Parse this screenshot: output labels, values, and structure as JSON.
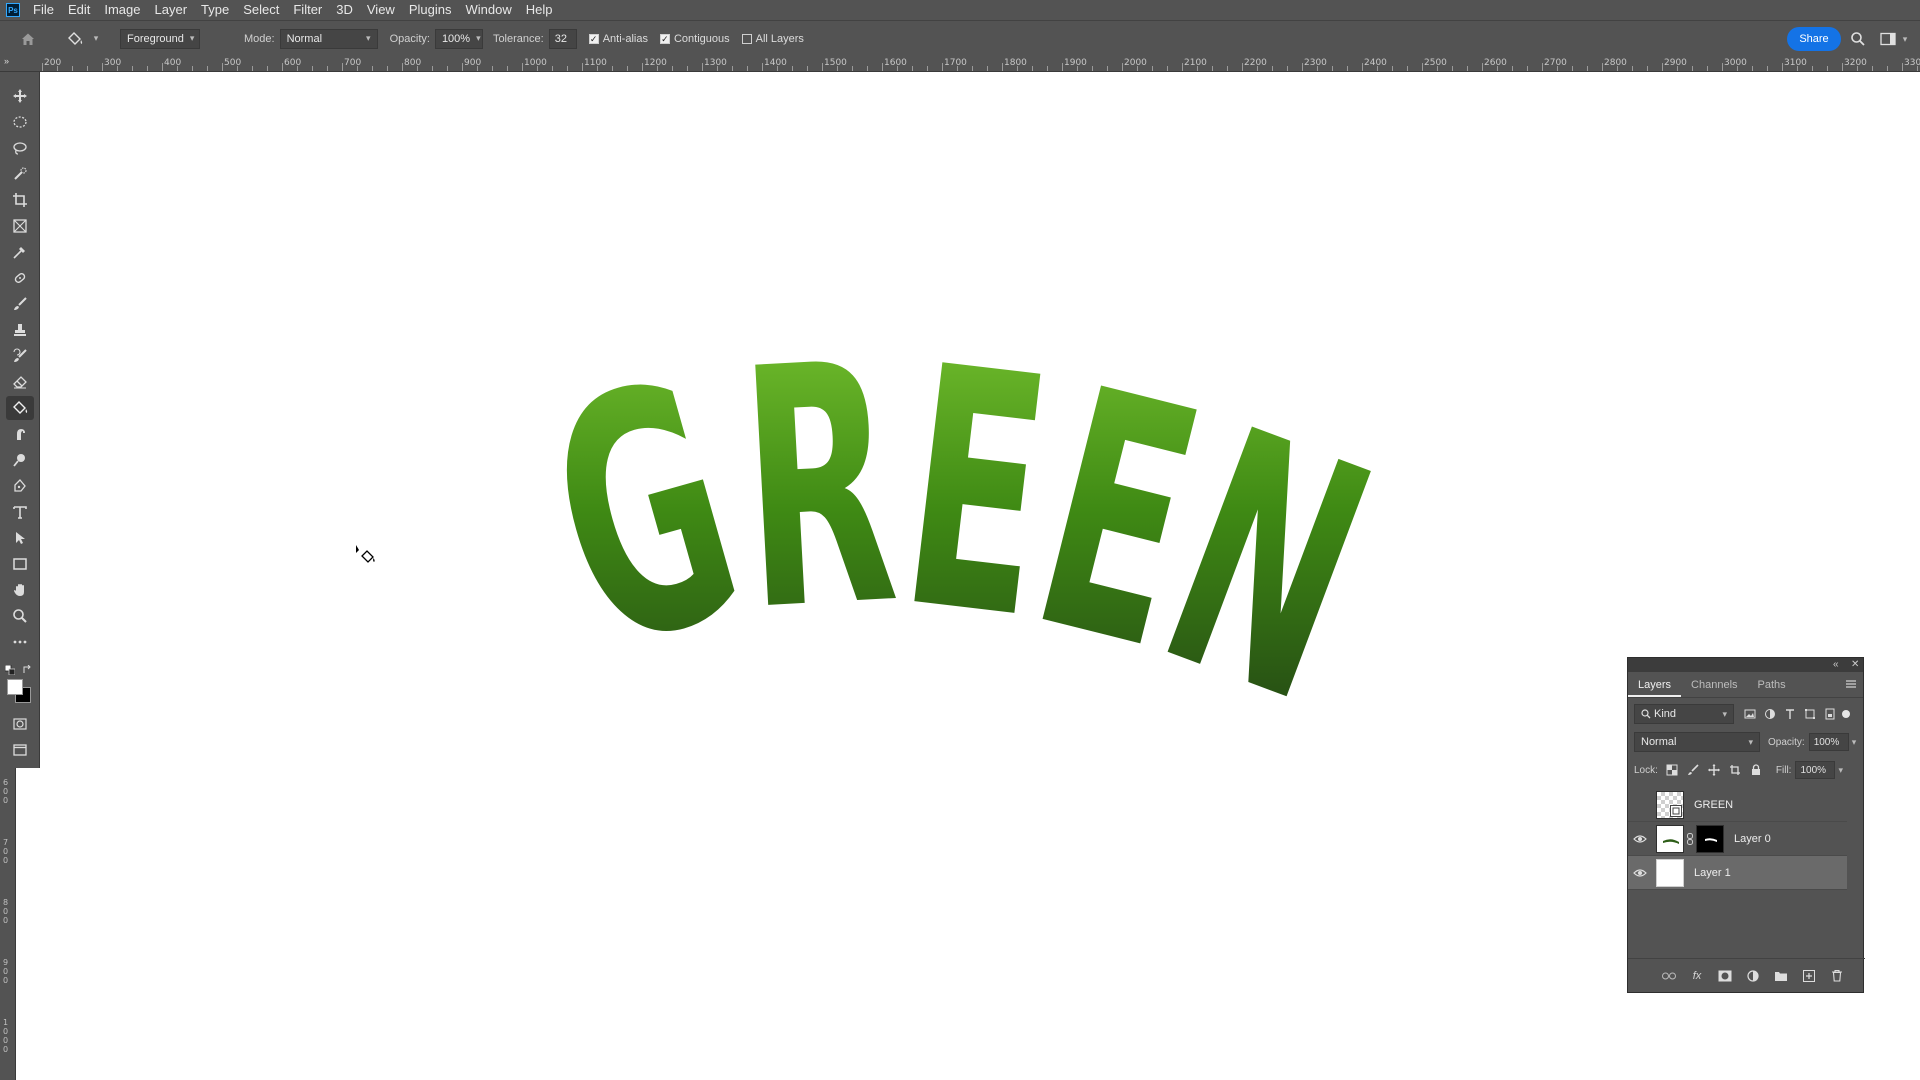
{
  "app": {
    "logo_text": "Ps"
  },
  "menu": [
    "File",
    "Edit",
    "Image",
    "Layer",
    "Type",
    "Select",
    "Filter",
    "3D",
    "View",
    "Plugins",
    "Window",
    "Help"
  ],
  "options": {
    "fill_source": "Foreground",
    "mode_label": "Mode:",
    "mode_value": "Normal",
    "opacity_label": "Opacity:",
    "opacity_value": "100%",
    "tolerance_label": "Tolerance:",
    "tolerance_value": "32",
    "anti_alias_label": "Anti-alias",
    "anti_alias_checked": true,
    "contiguous_label": "Contiguous",
    "contiguous_checked": true,
    "all_layers_label": "All Layers",
    "all_layers_checked": false,
    "share_label": "Share"
  },
  "ruler": {
    "top_labels": [
      "200",
      "300",
      "400",
      "500",
      "600",
      "700",
      "800",
      "900",
      "1000",
      "1100",
      "1200",
      "1300",
      "1400",
      "1500",
      "1600",
      "1700",
      "1800",
      "1900",
      "2000",
      "2100",
      "2200",
      "2300",
      "2400",
      "2500",
      "2600",
      "2700",
      "2800",
      "2900",
      "3000",
      "3100",
      "3200",
      "3300"
    ],
    "left_labels": [
      "600",
      "700",
      "800",
      "900",
      "1000"
    ]
  },
  "canvas": {
    "artwork_text": "GREEN",
    "colors": {
      "green_light": "#7cc832",
      "green_mid": "#3f8a14",
      "green_dark": "#1e3a14"
    }
  },
  "toolbar": {
    "foreground_color": "#ffffff",
    "background_color": "#000000"
  },
  "layers_panel": {
    "tabs": [
      "Layers",
      "Channels",
      "Paths"
    ],
    "active_tab": "Layers",
    "kind_label": "Kind",
    "blend_mode": "Normal",
    "opacity_label": "Opacity:",
    "opacity_value": "100%",
    "lock_label": "Lock:",
    "fill_label": "Fill:",
    "fill_value": "100%",
    "layers": [
      {
        "name": "GREEN",
        "visible": false,
        "thumb": "checker"
      },
      {
        "name": "Layer 0",
        "visible": true,
        "thumb": "white",
        "has_mask": true
      },
      {
        "name": "Layer 1",
        "visible": true,
        "thumb": "white",
        "selected": true
      }
    ],
    "footer_fx": "fx"
  }
}
